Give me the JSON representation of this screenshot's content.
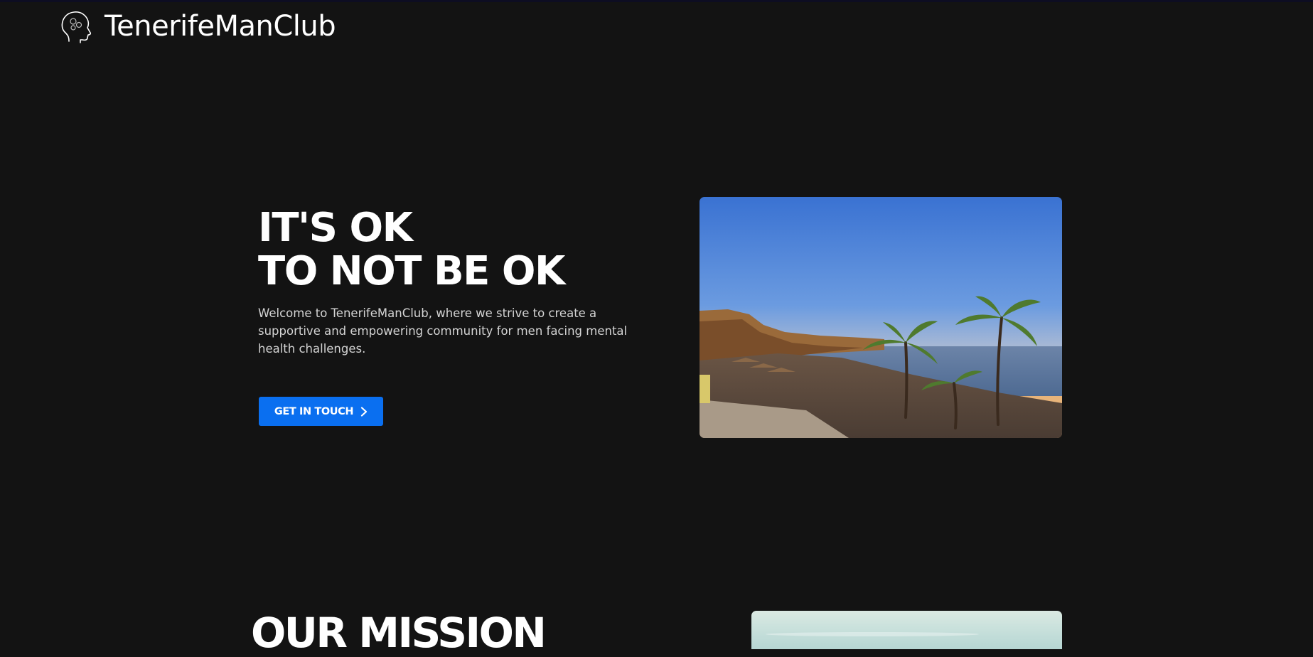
{
  "header": {
    "brand": "TenerifeManClub",
    "logo_icon": "head-gears-icon"
  },
  "hero": {
    "title_line1": "IT'S OK",
    "title_line2": "TO NOT BE OK",
    "description": "Welcome to TenerifeManClub, where we strive to create a supportive and empowering community for men facing mental health challenges.",
    "cta_label": "GET IN TOUCH",
    "cta_icon": "chevron-right-icon",
    "image_subject": "beach-sunset-photo"
  },
  "mission": {
    "title": "OUR MISSION"
  },
  "colors": {
    "background": "#131313",
    "accent": "#0a6ff0",
    "text": "#ffffff",
    "muted_text": "#d4d4d4"
  }
}
